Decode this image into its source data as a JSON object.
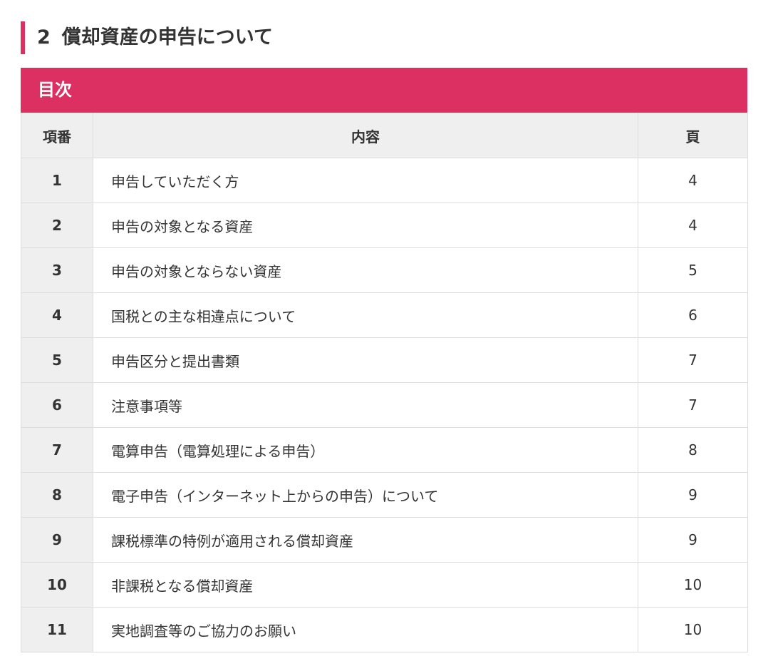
{
  "heading": {
    "number": "2",
    "title": "償却資産の申告について"
  },
  "toc": {
    "title": "目次",
    "columns": {
      "number": "項番",
      "content": "内容",
      "page": "頁"
    },
    "rows": [
      {
        "number": "1",
        "content": "申告していただく方",
        "page": "4"
      },
      {
        "number": "2",
        "content": "申告の対象となる資産",
        "page": "4"
      },
      {
        "number": "3",
        "content": "申告の対象とならない資産",
        "page": "5"
      },
      {
        "number": "4",
        "content": "国税との主な相違点について",
        "page": "6"
      },
      {
        "number": "5",
        "content": "申告区分と提出書類",
        "page": "7"
      },
      {
        "number": "6",
        "content": "注意事項等",
        "page": "7"
      },
      {
        "number": "7",
        "content": "電算申告（電算処理による申告）",
        "page": "8"
      },
      {
        "number": "8",
        "content": "電子申告（インターネット上からの申告）について",
        "page": "9"
      },
      {
        "number": "9",
        "content": "課税標準の特例が適用される償却資産",
        "page": "9"
      },
      {
        "number": "10",
        "content": "非課税となる償却資産",
        "page": "10"
      },
      {
        "number": "11",
        "content": "実地調査等のご協力のお願い",
        "page": "10"
      }
    ]
  },
  "colors": {
    "accent": "#dc3062",
    "header_bg": "#efefef",
    "border": "#dddddd",
    "text": "#333333"
  }
}
